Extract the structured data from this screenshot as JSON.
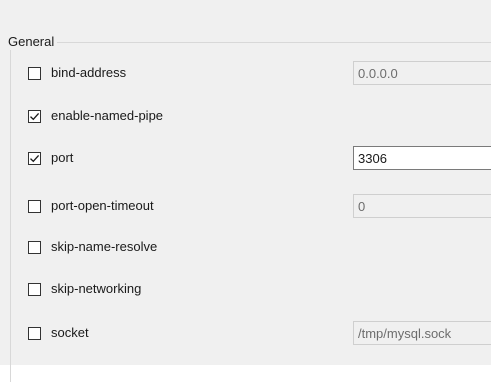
{
  "group": {
    "title": "General"
  },
  "options": [
    {
      "label": "bind-address",
      "checked": false,
      "value": "0.0.0.0",
      "input_enabled": false
    },
    {
      "label": "enable-named-pipe",
      "checked": true
    },
    {
      "label": "port",
      "checked": true,
      "value": "3306",
      "input_enabled": true
    },
    {
      "label": "port-open-timeout",
      "checked": false,
      "value": "0",
      "input_enabled": false
    },
    {
      "label": "skip-name-resolve",
      "checked": false
    },
    {
      "label": "skip-networking",
      "checked": false
    },
    {
      "label": "socket",
      "checked": false,
      "value": "/tmp/mysql.sock",
      "input_enabled": false
    }
  ],
  "icons": {
    "checked": "checkmark-icon"
  }
}
